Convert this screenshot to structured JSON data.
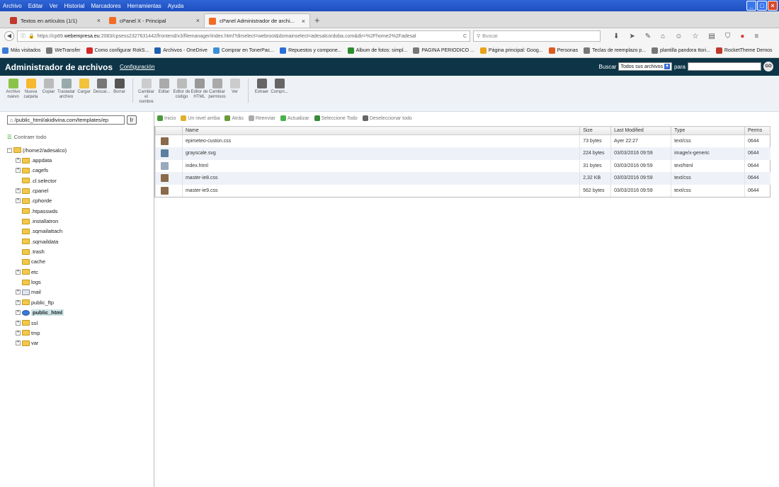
{
  "browser": {
    "menu": [
      "Archivo",
      "Editar",
      "Ver",
      "Historial",
      "Marcadores",
      "Herramientas",
      "Ayuda"
    ],
    "tabs": [
      {
        "label": "Textos en artículos (1/1)",
        "color": "#c0392b"
      },
      {
        "label": "cPanel X - Principal",
        "color": "#f26b23"
      },
      {
        "label": "cPanel Administrador de archi...",
        "color": "#f26b23",
        "active": true
      }
    ],
    "url_prefix": "https://cp89.",
    "url_domain": "webempresa.eu",
    "url_rest": ":2083/cpsess2327631442/frontend/x3/filemanager/index.html?dirselect=webroot&domainselect=adesalcordoba.com&dir=%2Fhome2%2Fadesal",
    "search_placeholder": "Buscar",
    "bookmarks": [
      {
        "label": "Más visitados",
        "color": "#3a7bd5"
      },
      {
        "label": "WeTransfer",
        "color": "#777"
      },
      {
        "label": "Como configurar RokS...",
        "color": "#d62828"
      },
      {
        "label": "Archivos - OneDrive",
        "color": "#1e5fb0"
      },
      {
        "label": "Comprar en TonerPac...",
        "color": "#3a8fd8"
      },
      {
        "label": "Repuestos y compone...",
        "color": "#2a6fd8"
      },
      {
        "label": "Album de fotos: simpl...",
        "color": "#2e8b2e"
      },
      {
        "label": "PAGINA PERIODICO ...",
        "color": "#777"
      },
      {
        "label": "Página principal: Goog...",
        "color": "#e8a317"
      },
      {
        "label": "Personas",
        "color": "#e05a1e"
      },
      {
        "label": "Teclas de reemplazo p...",
        "color": "#777"
      },
      {
        "label": "plantilla pandora ttori...",
        "color": "#777"
      },
      {
        "label": "RocketTheme Demos",
        "color": "#c0392b"
      }
    ]
  },
  "cpanel": {
    "title": "Administrador de archivos",
    "config_link": "Configuración",
    "search_label": "Buscar",
    "search_select": "Todos sus archivos",
    "search_for": "para",
    "go_label": "GO",
    "toolbar": [
      {
        "label": "Archivo nuevo",
        "color": "#8bc34a"
      },
      {
        "label": "Nueva carpeta",
        "color": "#f5b82e"
      },
      {
        "label": "Copiar",
        "color": "#bbb"
      },
      {
        "label": "Trasladar archivo",
        "color": "#9aa"
      },
      {
        "label": "Cargar",
        "color": "#f2c23a"
      },
      {
        "label": "Descar...",
        "color": "#777"
      },
      {
        "label": "Borrar",
        "color": "#555"
      },
      {
        "label": "Cambiar el nombre",
        "color": "#ccc"
      },
      {
        "label": "Editar",
        "color": "#aaa"
      },
      {
        "label": "Editor de código",
        "color": "#bbb"
      },
      {
        "label": "Editor de HTML",
        "color": "#999"
      },
      {
        "label": "Cambiar permisos",
        "color": "#aaa"
      },
      {
        "label": "Ver",
        "color": "#ccc"
      },
      {
        "label": "Extraer",
        "color": "#666"
      },
      {
        "label": "Compri...",
        "color": "#666"
      }
    ],
    "path_value": "/public_html/akidivina.com/templates/ep",
    "go_path_label": "Ir",
    "collapse_all": "Contraer todo",
    "tree": [
      {
        "label": "(/home2/adesalco)",
        "level": 0,
        "pm": "-",
        "root": true
      },
      {
        "label": ".appdata",
        "level": 1,
        "pm": "+"
      },
      {
        "label": ".cagefs",
        "level": 1,
        "pm": "+"
      },
      {
        "label": ".cl.selector",
        "level": 1,
        "pm": ""
      },
      {
        "label": ".cpanel",
        "level": 1,
        "pm": "+"
      },
      {
        "label": ".cphorde",
        "level": 1,
        "pm": "+"
      },
      {
        "label": ".htpasswds",
        "level": 1,
        "pm": ""
      },
      {
        "label": ".installatron",
        "level": 1,
        "pm": ""
      },
      {
        "label": ".sqmailattach",
        "level": 1,
        "pm": ""
      },
      {
        "label": ".sqmaildata",
        "level": 1,
        "pm": ""
      },
      {
        "label": ".trash",
        "level": 1,
        "pm": ""
      },
      {
        "label": "cache",
        "level": 1,
        "pm": ""
      },
      {
        "label": "etc",
        "level": 1,
        "pm": "+"
      },
      {
        "label": "logs",
        "level": 1,
        "pm": ""
      },
      {
        "label": "mail",
        "level": 1,
        "pm": "+"
      },
      {
        "label": "public_ftp",
        "level": 1,
        "pm": "+"
      },
      {
        "label": "public_html",
        "level": 1,
        "pm": "+",
        "selected": true
      },
      {
        "label": "ssl",
        "level": 1,
        "pm": "+"
      },
      {
        "label": "tmp",
        "level": 1,
        "pm": "+"
      },
      {
        "label": "var",
        "level": 1,
        "pm": "+"
      }
    ],
    "actions": [
      {
        "label": "Inicio",
        "color": "#4a9a3a"
      },
      {
        "label": "Un nivel arriba",
        "color": "#e0b030"
      },
      {
        "label": "Atrás",
        "color": "#6a9a3a"
      },
      {
        "label": "Reenviar",
        "color": "#aaa"
      },
      {
        "label": "Actualizar",
        "color": "#4ab04a"
      },
      {
        "label": "Seleccione Todo",
        "color": "#3a8a3a"
      },
      {
        "label": "Deseleccionar todo",
        "color": "#666"
      }
    ],
    "columns": [
      "Name",
      "Size",
      "Last Modified",
      "Type",
      "Perms"
    ],
    "files": [
      {
        "name": "epimeteo-custon.css",
        "size": "73 bytes",
        "modified": "Ayer 22:27",
        "type": "text/css",
        "perms": "0644",
        "icon": "#8a6a4a"
      },
      {
        "name": "grayscale.svg",
        "size": "224 bytes",
        "modified": "03/03/2016 09:59",
        "type": "image/x-generic",
        "perms": "0644",
        "icon": "#5a7fa0"
      },
      {
        "name": "index.html",
        "size": "31 bytes",
        "modified": "03/03/2016 09:59",
        "type": "text/html",
        "perms": "0644",
        "icon": "#9ab"
      },
      {
        "name": "master-ie8.css",
        "size": "2,32 KB",
        "modified": "03/03/2016 09:59",
        "type": "text/css",
        "perms": "0644",
        "icon": "#8a6a4a"
      },
      {
        "name": "master-ie9.css",
        "size": "562 bytes",
        "modified": "03/03/2016 09:59",
        "type": "text/css",
        "perms": "0644",
        "icon": "#8a6a4a"
      }
    ]
  }
}
